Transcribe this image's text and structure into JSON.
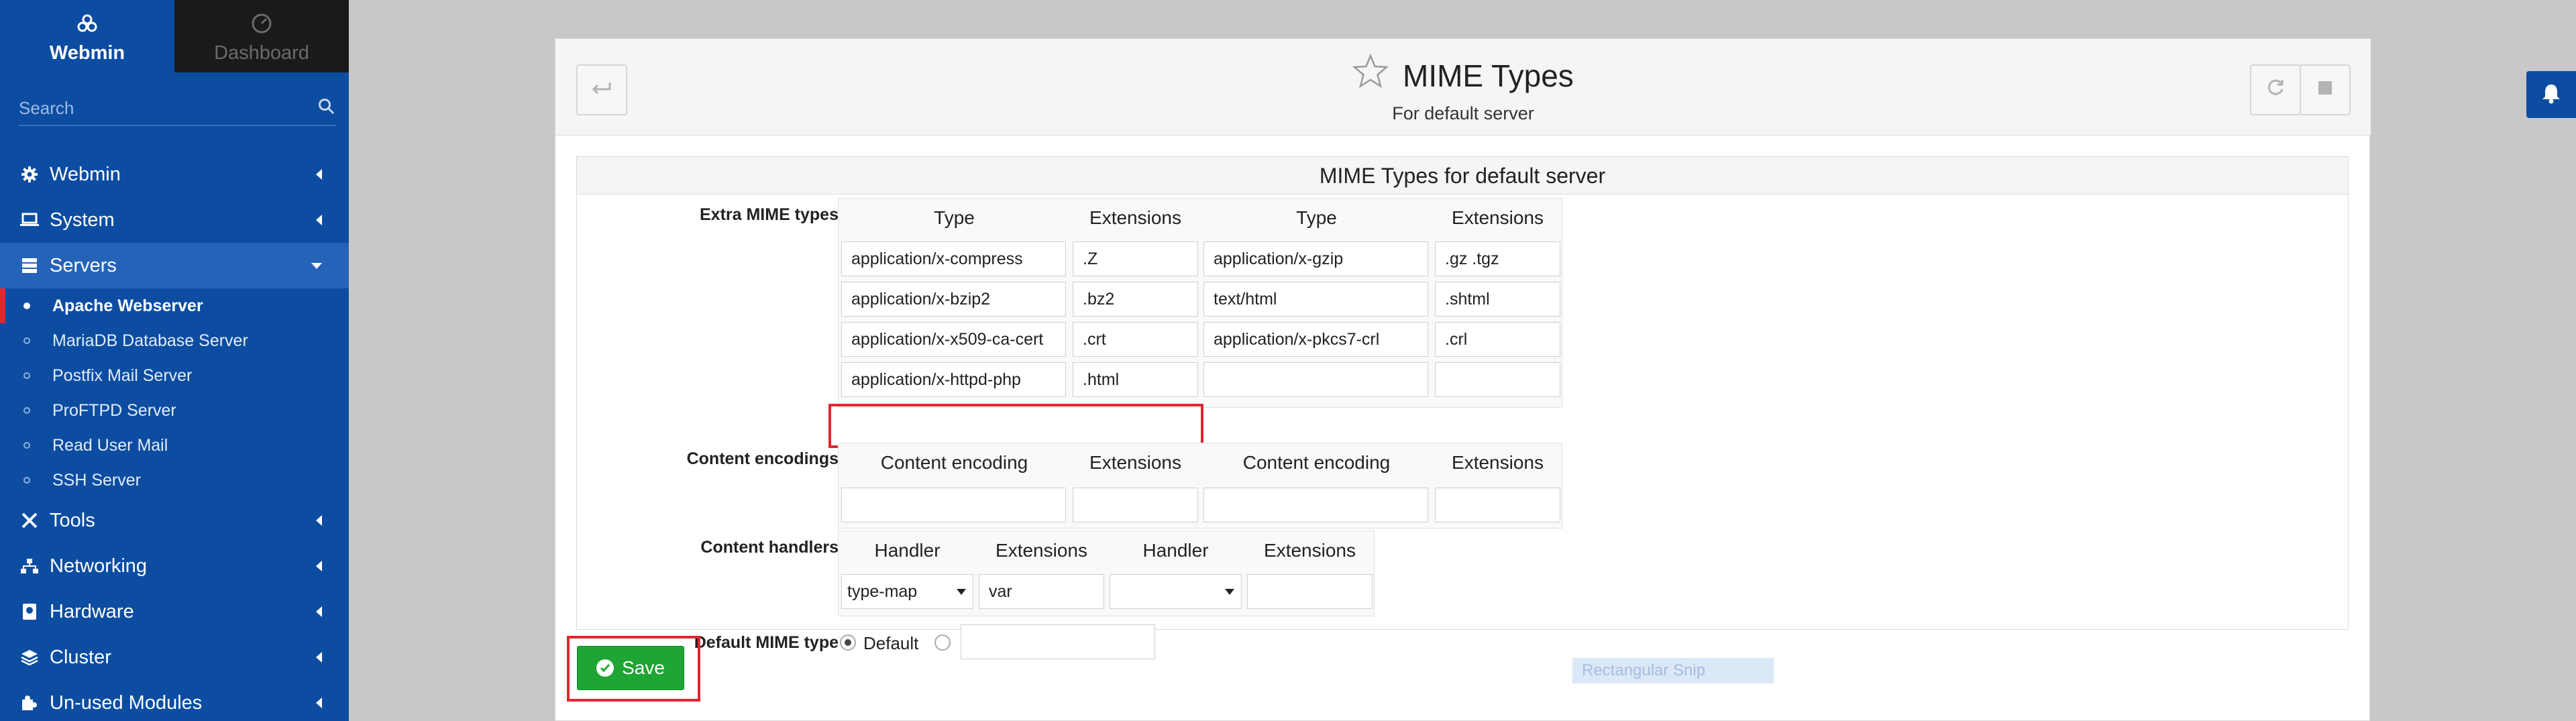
{
  "sidebar": {
    "tabs": [
      {
        "label": "Webmin",
        "icon": "webmin-logo-icon"
      },
      {
        "label": "Dashboard",
        "icon": "dashboard-gauge-icon"
      }
    ],
    "search_placeholder": "Search",
    "menu": [
      {
        "label": "Webmin",
        "icon": "gear-icon"
      },
      {
        "label": "System",
        "icon": "laptop-icon"
      },
      {
        "label": "Servers",
        "icon": "server-icon"
      },
      {
        "label": "Tools",
        "icon": "tools-icon"
      },
      {
        "label": "Networking",
        "icon": "network-icon"
      },
      {
        "label": "Hardware",
        "icon": "hard-drive-icon"
      },
      {
        "label": "Cluster",
        "icon": "layers-icon"
      },
      {
        "label": "Un-used Modules",
        "icon": "puzzle-icon"
      }
    ],
    "servers_submenu": [
      "Apache Webserver",
      "MariaDB Database Server",
      "Postfix Mail Server",
      "ProFTPD Server",
      "Read User Mail",
      "SSH Server"
    ]
  },
  "page": {
    "title": "MIME Types",
    "subtitle": "For default server",
    "form_title": "MIME Types for default server"
  },
  "extra_mime": {
    "label": "Extra MIME types",
    "headers": [
      "Type",
      "Extensions",
      "Type",
      "Extensions"
    ],
    "rows": [
      [
        "application/x-compress",
        ".Z",
        "application/x-gzip",
        ".gz .tgz"
      ],
      [
        "application/x-bzip2",
        ".bz2",
        "text/html",
        ".shtml"
      ],
      [
        "application/x-x509-ca-cert",
        ".crt",
        "application/x-pkcs7-crl",
        ".crl"
      ],
      [
        "application/x-httpd-php",
        ".html",
        "",
        ""
      ]
    ]
  },
  "content_encodings": {
    "label": "Content encodings",
    "headers": [
      "Content encoding",
      "Extensions",
      "Content encoding",
      "Extensions"
    ],
    "rows": [
      [
        "",
        "",
        "",
        ""
      ]
    ]
  },
  "content_handlers": {
    "label": "Content handlers",
    "headers": [
      "Handler",
      "Extensions",
      "Handler",
      "Extensions"
    ],
    "rows": [
      [
        "type-map",
        "var",
        "",
        ""
      ]
    ]
  },
  "default_mime": {
    "label": "Default MIME type",
    "option_default": "Default",
    "selected": "Default",
    "value": ""
  },
  "buttons": {
    "save": "Save"
  },
  "ghost_text": "Rectangular Snip",
  "colors": {
    "sidebar": "#0c4da2",
    "save": "#1ea533",
    "highlight": "#e3262f"
  }
}
